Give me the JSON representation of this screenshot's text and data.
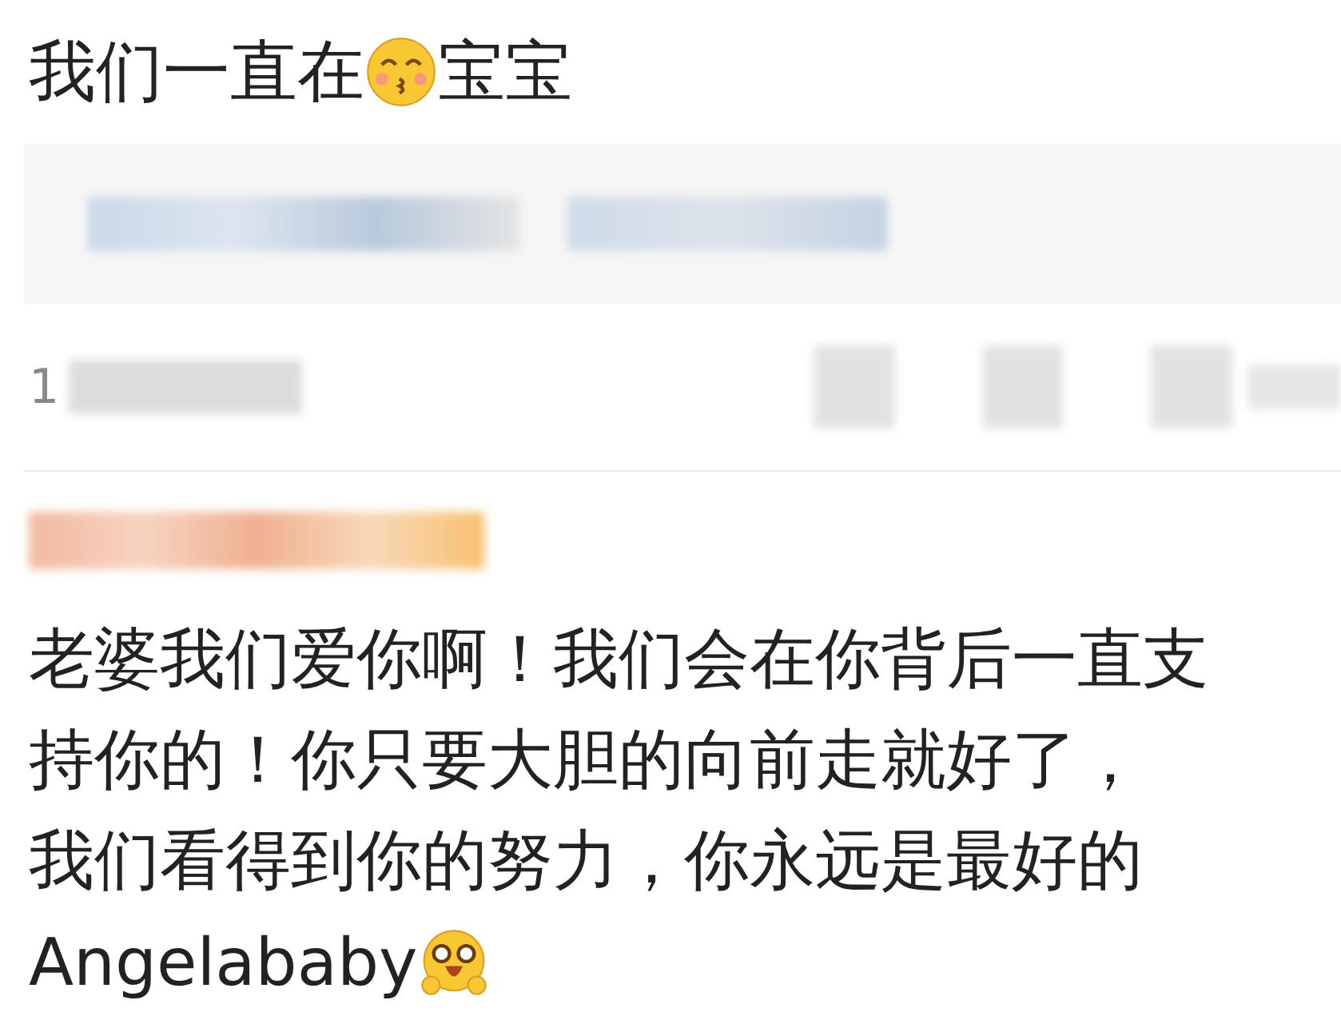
{
  "post": {
    "segments": [
      {
        "kind": "text",
        "text": "我们一直在"
      },
      {
        "kind": "kiss"
      },
      {
        "kind": "text",
        "text": "宝宝"
      }
    ]
  },
  "stats": {
    "count": "1"
  },
  "comment": {
    "lines": [
      [
        {
          "kind": "text",
          "text": "老婆我们爱你啊！我们会在你背后一直支"
        }
      ],
      [
        {
          "kind": "text",
          "text": "持你的！你只要大胆的向前走就好了，"
        }
      ],
      [
        {
          "kind": "text",
          "text": "我们看得到你的努力，你永远是最好的"
        }
      ],
      [
        {
          "kind": "text",
          "text": "Angelababy"
        },
        {
          "kind": "excited"
        }
      ]
    ]
  }
}
